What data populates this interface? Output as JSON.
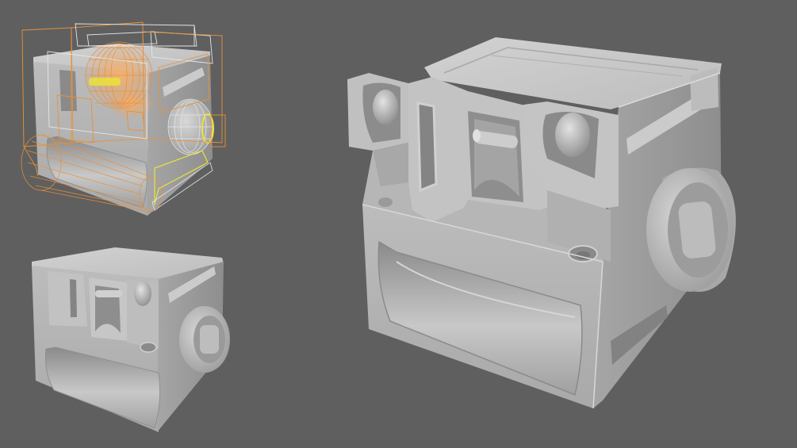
{
  "scene": {
    "background": "#5f5f5f",
    "views": [
      {
        "name": "wireframe-xray-view",
        "style": "shaded with orange wireframe overlay and yellow selection highlights"
      },
      {
        "name": "shaded-small-view",
        "style": "gray shaded"
      },
      {
        "name": "shaded-large-view",
        "style": "gray shaded"
      }
    ]
  },
  "colors": {
    "body": "#b8b8b8",
    "body_light": "#cfcfcf",
    "body_dark": "#8d8d8d",
    "wire_orange": "#e8913a",
    "wire_white": "#e6e6e6",
    "highlight_yellow": "#e9e33a"
  }
}
